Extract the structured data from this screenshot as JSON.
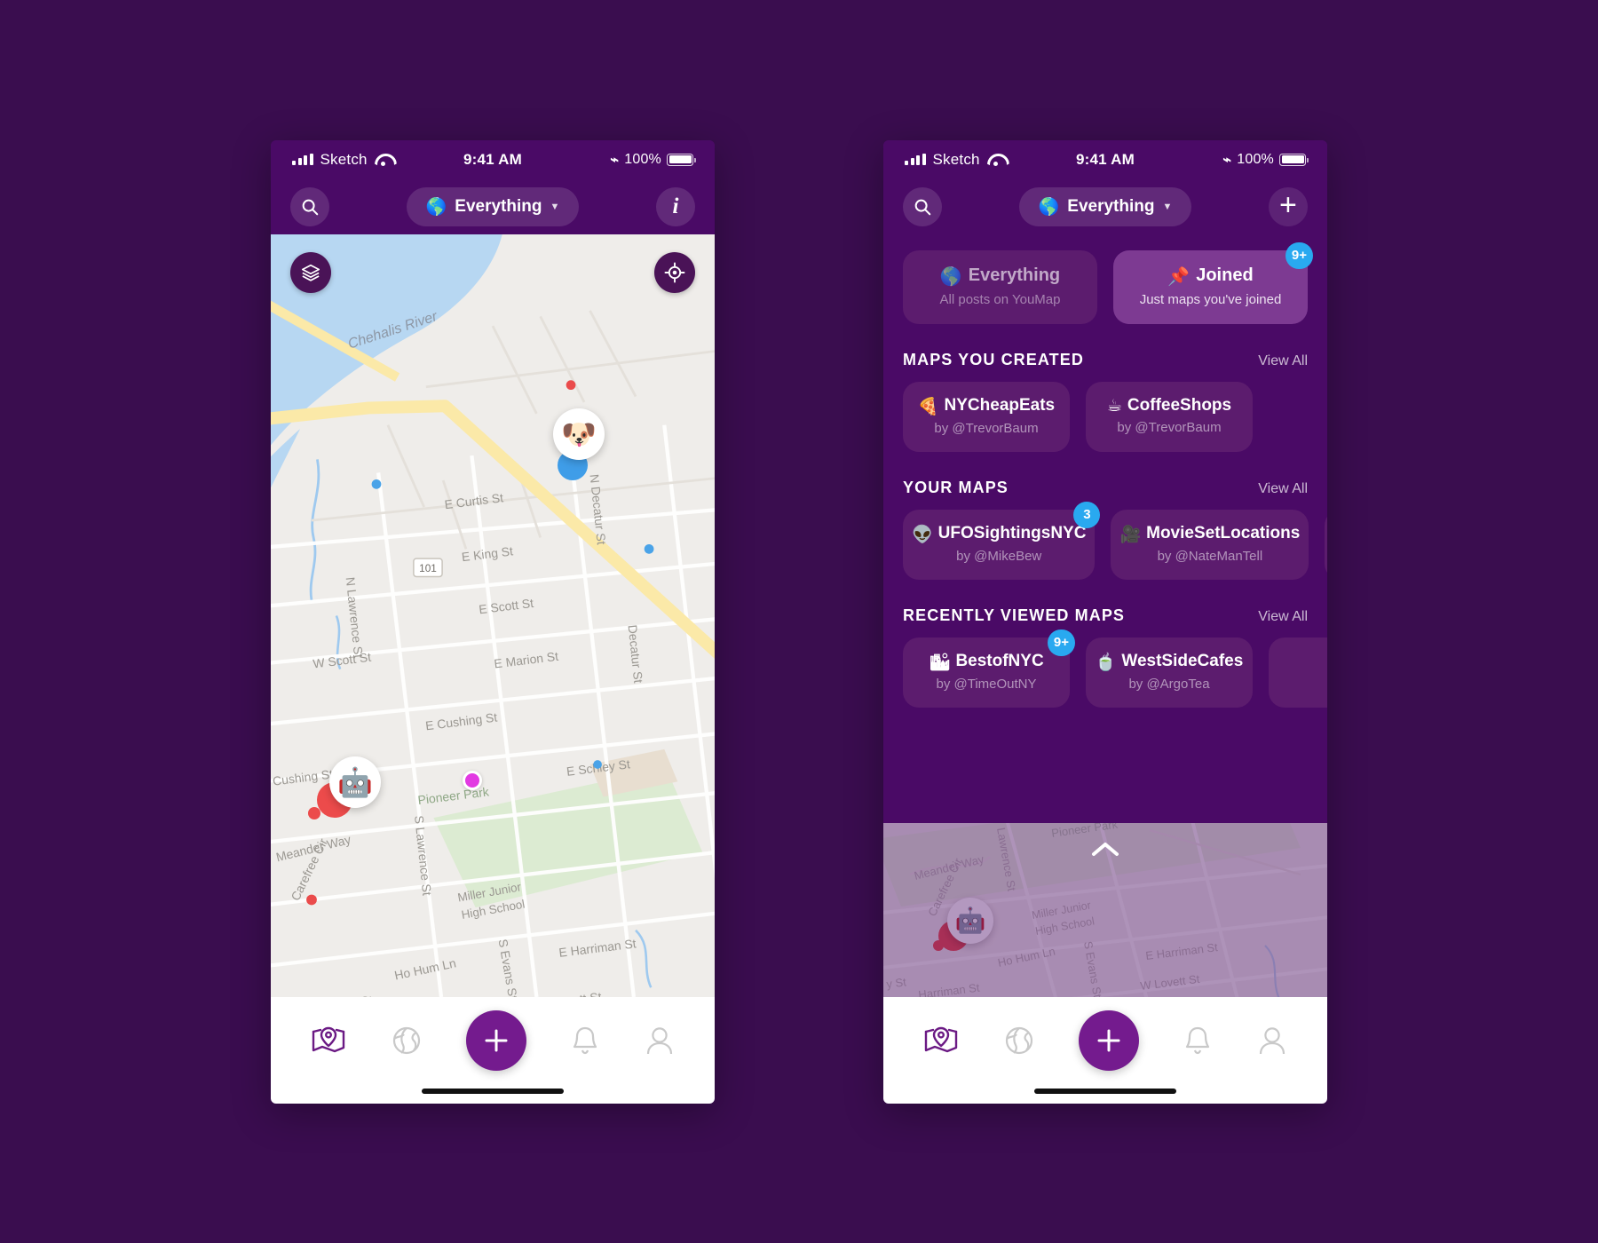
{
  "status_bar": {
    "carrier": "Sketch",
    "time": "9:41 AM",
    "battery_pct": "100%",
    "signal_icon": "cellular-signal-icon",
    "wifi_icon": "wifi-icon",
    "bluetooth_icon": "bluetooth-icon",
    "battery_icon": "battery-icon"
  },
  "header": {
    "search_icon": "search-icon",
    "filter_label": "Everything",
    "filter_emoji": "🌎",
    "caret": "▼",
    "info_label": "i",
    "plus_label": "+"
  },
  "map": {
    "layers_icon": "layers-icon",
    "locate_icon": "locate-icon",
    "labels": {
      "river": "Chehalis River",
      "highway": "101",
      "park": "Pioneer Park",
      "school": "Miller Junior\nHigh School",
      "streets": [
        "E Curtis St",
        "E King St",
        "E Scott St",
        "E Marion St",
        "W Scott St",
        "E Cushing St",
        "W Cushing St",
        "N Lawrence St",
        "S Lawrence St",
        "N Decatur St",
        "Decatur St",
        "E Schley St",
        "Meander Way",
        "Carefree Cir",
        "Ho Hum Ln",
        "S Evans St",
        "E Harriman St",
        "W Harriman St",
        "W Lovett St"
      ]
    },
    "pins": [
      {
        "name": "dog-post-pin",
        "emoji": "🐶"
      },
      {
        "name": "robot-post-pin",
        "emoji": "🤖"
      }
    ]
  },
  "modes": [
    {
      "id": "everything",
      "emoji": "🌎",
      "title": "Everything",
      "subtitle": "All posts on YouMap",
      "active": false,
      "badge": ""
    },
    {
      "id": "joined",
      "emoji": "📌",
      "title": "Joined",
      "subtitle": "Just maps you've joined",
      "active": true,
      "badge": "9+"
    }
  ],
  "sections": [
    {
      "id": "maps-you-created",
      "title": "MAPS YOU CREATED",
      "view_all": "View All",
      "cards": [
        {
          "emoji": "🍕",
          "name": "NYCheapEats",
          "author": "by @TrevorBaum",
          "badge": ""
        },
        {
          "emoji": "☕",
          "name": "CoffeeShops",
          "author": "by @TrevorBaum",
          "badge": ""
        }
      ]
    },
    {
      "id": "your-maps",
      "title": "YOUR MAPS",
      "view_all": "View All",
      "cards": [
        {
          "emoji": "👽",
          "name": "UFOSightingsNYC",
          "author": "by @MikeBew",
          "badge": "3"
        },
        {
          "emoji": "🎥",
          "name": "MovieSetLocations",
          "author": "by @NateManTell",
          "badge": ""
        }
      ]
    },
    {
      "id": "recently-viewed-maps",
      "title": "RECENTLY VIEWED MAPS",
      "view_all": "View All",
      "cards": [
        {
          "emoji": "🏙",
          "name": "BestofNYC",
          "author": "by @TimeOutNY",
          "badge": "9+"
        },
        {
          "emoji": "🍵",
          "name": "WestSideCafes",
          "author": "by @ArgoTea",
          "badge": ""
        }
      ]
    }
  ],
  "peek": {
    "chevron_icon": "chevron-up-icon"
  },
  "tabbar": {
    "items": [
      {
        "id": "maps",
        "icon": "map-pin-icon",
        "active": true
      },
      {
        "id": "explore",
        "icon": "globe-icon",
        "active": false
      },
      {
        "id": "create",
        "icon": "plus-icon",
        "active": false
      },
      {
        "id": "notifications",
        "icon": "bell-icon",
        "active": false
      },
      {
        "id": "profile",
        "icon": "person-icon",
        "active": false
      }
    ]
  },
  "colors": {
    "page_bg": "#3a0d4f",
    "phone_purple": "#4a0a66",
    "card_purple": "#5c1c6e",
    "card_active": "#7d3a92",
    "accent": "#741b8e",
    "badge_blue": "#29a9f0"
  }
}
